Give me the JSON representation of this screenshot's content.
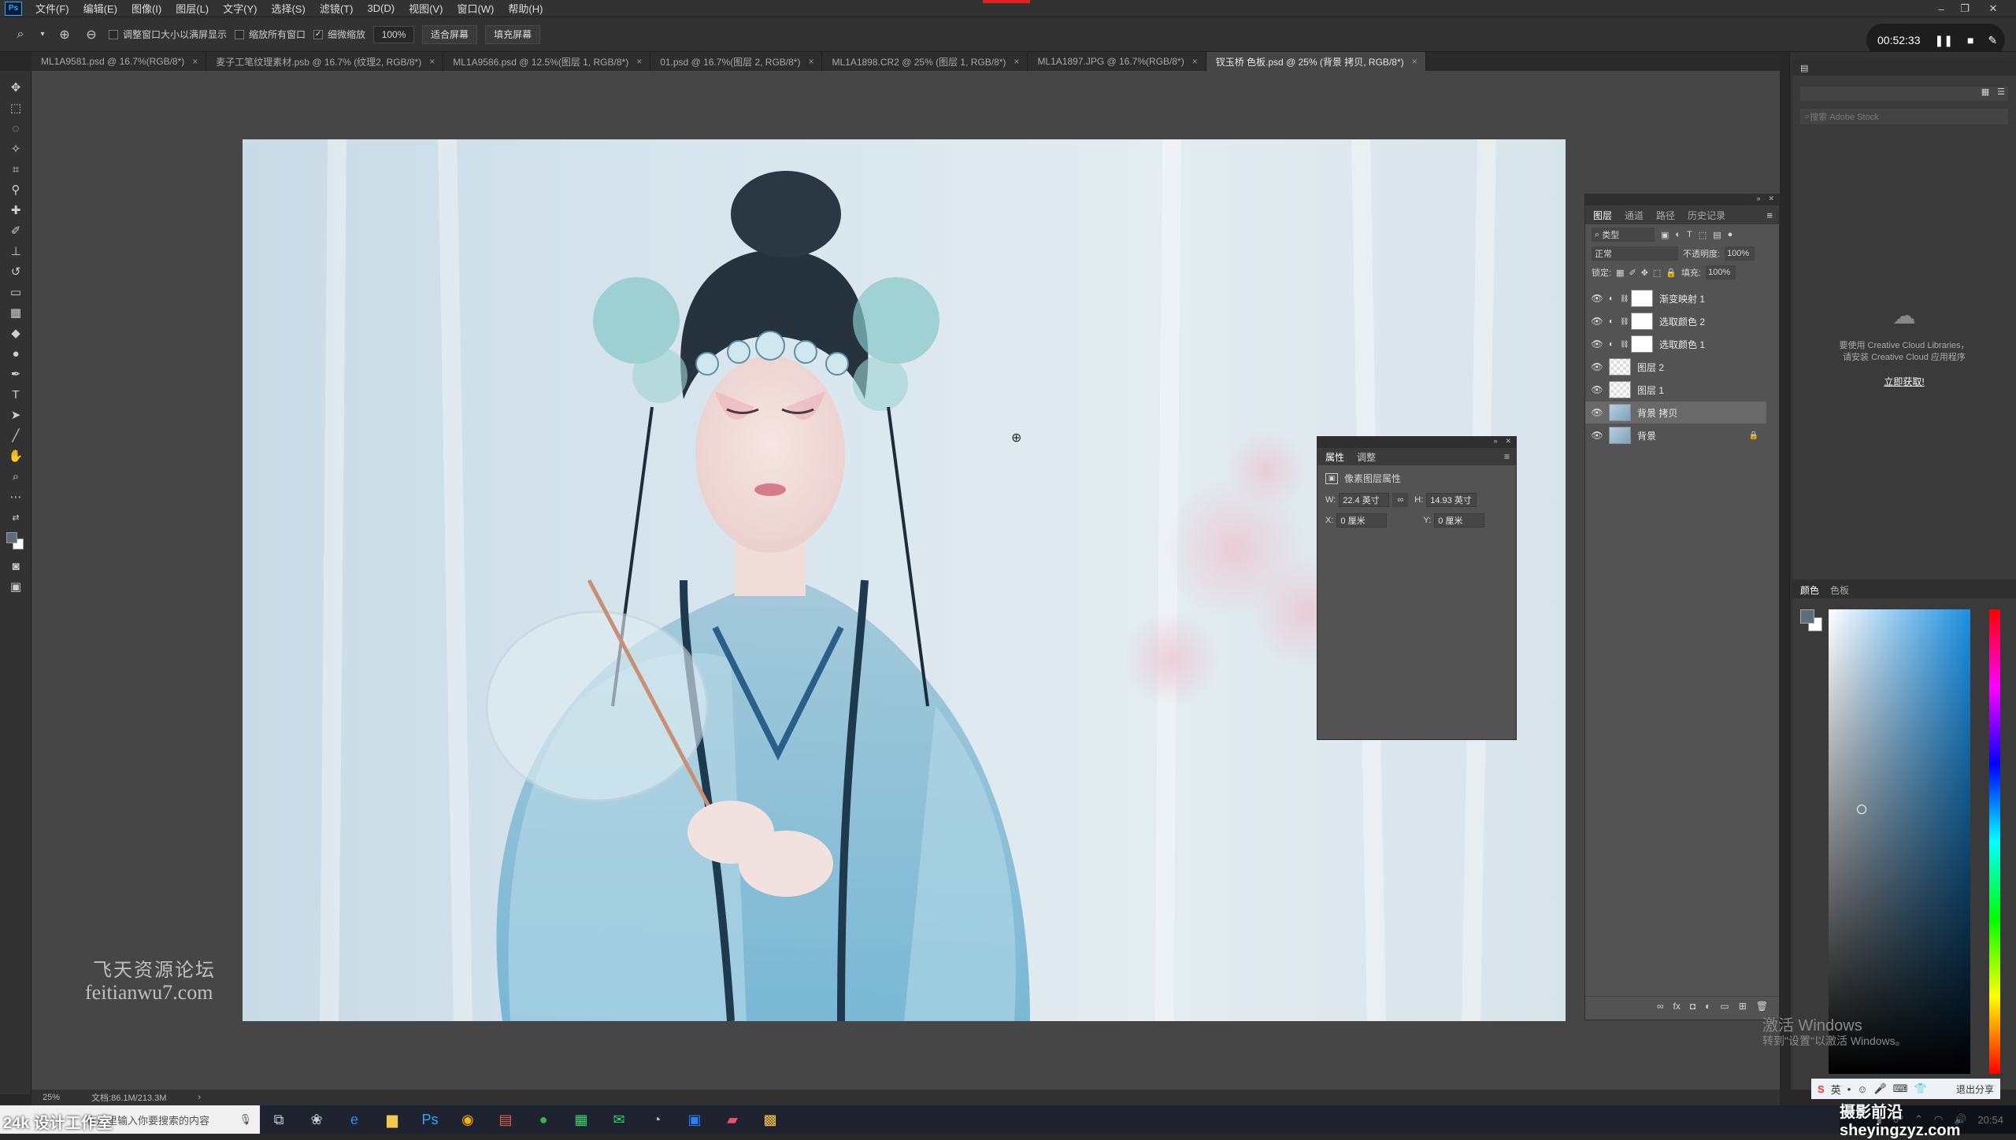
{
  "menu": {
    "app_logo": "Ps",
    "items": [
      "文件(F)",
      "编辑(E)",
      "图像(I)",
      "图层(L)",
      "文字(Y)",
      "选择(S)",
      "滤镜(T)",
      "3D(D)",
      "视图(V)",
      "窗口(W)",
      "帮助(H)"
    ]
  },
  "options": {
    "resize_label": "调整窗口大小以满屏显示",
    "zoom_all_label": "缩放所有窗口",
    "scrubby_label": "细微缩放",
    "zoom_value": "100%",
    "fit_screen": "适合屏幕",
    "fill_screen": "填充屏幕"
  },
  "recorder": {
    "time": "00:52:33"
  },
  "tabs": [
    {
      "label": "ML1A9581.psd @ 16.7%(RGB/8*)"
    },
    {
      "label": "麦子工笔纹理素材.psb @ 16.7% (纹理2, RGB/8*)"
    },
    {
      "label": "ML1A9586.psd @ 12.5%(图层 1, RGB/8*)"
    },
    {
      "label": "01.psd @ 16.7%(图层 2, RGB/8*)"
    },
    {
      "label": "ML1A1898.CR2 @ 25% (图层 1, RGB/8*)"
    },
    {
      "label": "ML1A1897.JPG @ 16.7%(RGB/8*)"
    },
    {
      "label": "钗玉桥 色板.psd @ 25% (背景 拷贝, RGB/8*)"
    }
  ],
  "properties": {
    "tab_props": "属性",
    "tab_adjust": "调整",
    "title": "像素图层属性",
    "w_label": "W:",
    "w_value": "22.4 英寸",
    "h_label": "H:",
    "h_value": "14.93 英寸",
    "x_label": "X:",
    "x_value": "0 厘米",
    "y_label": "Y:",
    "y_value": "0 厘米"
  },
  "layers_panel": {
    "tabs": [
      "图层",
      "通道",
      "路径",
      "历史记录"
    ],
    "filter_label": "类型",
    "blend_mode": "正常",
    "opacity_label": "不透明度:",
    "opacity_value": "100%",
    "lock_label": "锁定:",
    "fill_label": "填充:",
    "fill_value": "100%",
    "layers": [
      {
        "name": "渐变映射 1",
        "thumb": "white",
        "adjust": true,
        "selected": false
      },
      {
        "name": "选取颜色 2",
        "thumb": "white",
        "adjust": true,
        "selected": false
      },
      {
        "name": "选取颜色 1",
        "thumb": "white",
        "adjust": true,
        "selected": false
      },
      {
        "name": "图层 2",
        "thumb": "check",
        "adjust": false,
        "selected": false
      },
      {
        "name": "图层 1",
        "thumb": "check",
        "adjust": false,
        "selected": false
      },
      {
        "name": "背景 拷贝",
        "thumb": "photo",
        "adjust": false,
        "selected": true
      },
      {
        "name": "背景",
        "thumb": "photo",
        "adjust": false,
        "selected": false,
        "locked": true
      }
    ]
  },
  "libraries": {
    "search_placeholder": "搜索 Adobe Stock",
    "message_line1": "要使用 Creative Cloud Libraries，",
    "message_line2": "请安装 Creative Cloud 应用程序",
    "link": "立即获取!"
  },
  "color_panel": {
    "tab_color": "颜色",
    "tab_swatches": "色板"
  },
  "status": {
    "zoom": "25%",
    "doc": "文档:86.1M/213.3M"
  },
  "watermark": {
    "cn": "飞天资源论坛",
    "en": "feitianwu7.com"
  },
  "activation": {
    "line1": "激活 Windows",
    "line2": "转到\"设置\"以激活 Windows。"
  },
  "taskbar": {
    "search_placeholder": "在这里输入你要搜索的内容",
    "overlay_text": "24k 设计工作室",
    "share_label": "退出分享",
    "site_watermark": "摄影前沿 sheyingzyz.com",
    "time": "20:54"
  }
}
